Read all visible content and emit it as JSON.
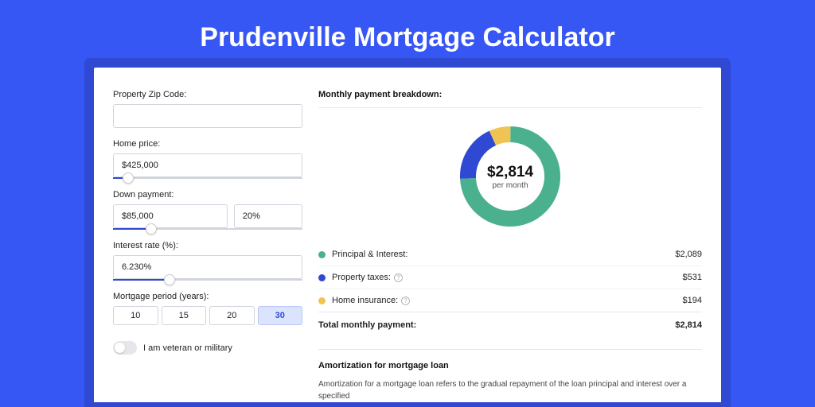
{
  "page_title": "Prudenville Mortgage Calculator",
  "form": {
    "zip_label": "Property Zip Code:",
    "zip_value": "",
    "home_price_label": "Home price:",
    "home_price_value": "$425,000",
    "down_payment_label": "Down payment:",
    "down_payment_value": "$85,000",
    "down_payment_pct": "20%",
    "interest_label": "Interest rate (%):",
    "interest_value": "6.230%",
    "period_label": "Mortgage period (years):",
    "periods": [
      "10",
      "15",
      "20",
      "30"
    ],
    "selected_period": "30",
    "veteran_label": "I am veteran or military"
  },
  "breakdown": {
    "header": "Monthly payment breakdown:",
    "center_amount": "$2,814",
    "center_sub": "per month",
    "rows": [
      {
        "color": "#4ab08d",
        "label": "Principal & Interest:",
        "value": "$2,089",
        "info": false
      },
      {
        "color": "#2f49d3",
        "label": "Property taxes:",
        "value": "$531",
        "info": true
      },
      {
        "color": "#f0c453",
        "label": "Home insurance:",
        "value": "$194",
        "info": true
      }
    ],
    "total_label": "Total monthly payment:",
    "total_value": "$2,814"
  },
  "amort": {
    "header": "Amortization for mortgage loan",
    "text": "Amortization for a mortgage loan refers to the gradual repayment of the loan principal and interest over a specified"
  },
  "chart_data": {
    "type": "pie",
    "title": "Monthly payment breakdown",
    "series": [
      {
        "name": "Principal & Interest",
        "value": 2089,
        "color": "#4ab08d"
      },
      {
        "name": "Property taxes",
        "value": 531,
        "color": "#2f49d3"
      },
      {
        "name": "Home insurance",
        "value": 194,
        "color": "#f0c453"
      }
    ],
    "total": 2814,
    "center_label": "$2,814 per month"
  },
  "sliders": {
    "home_price_pct": 8,
    "down_payment_pct": 20,
    "interest_pct": 30
  }
}
